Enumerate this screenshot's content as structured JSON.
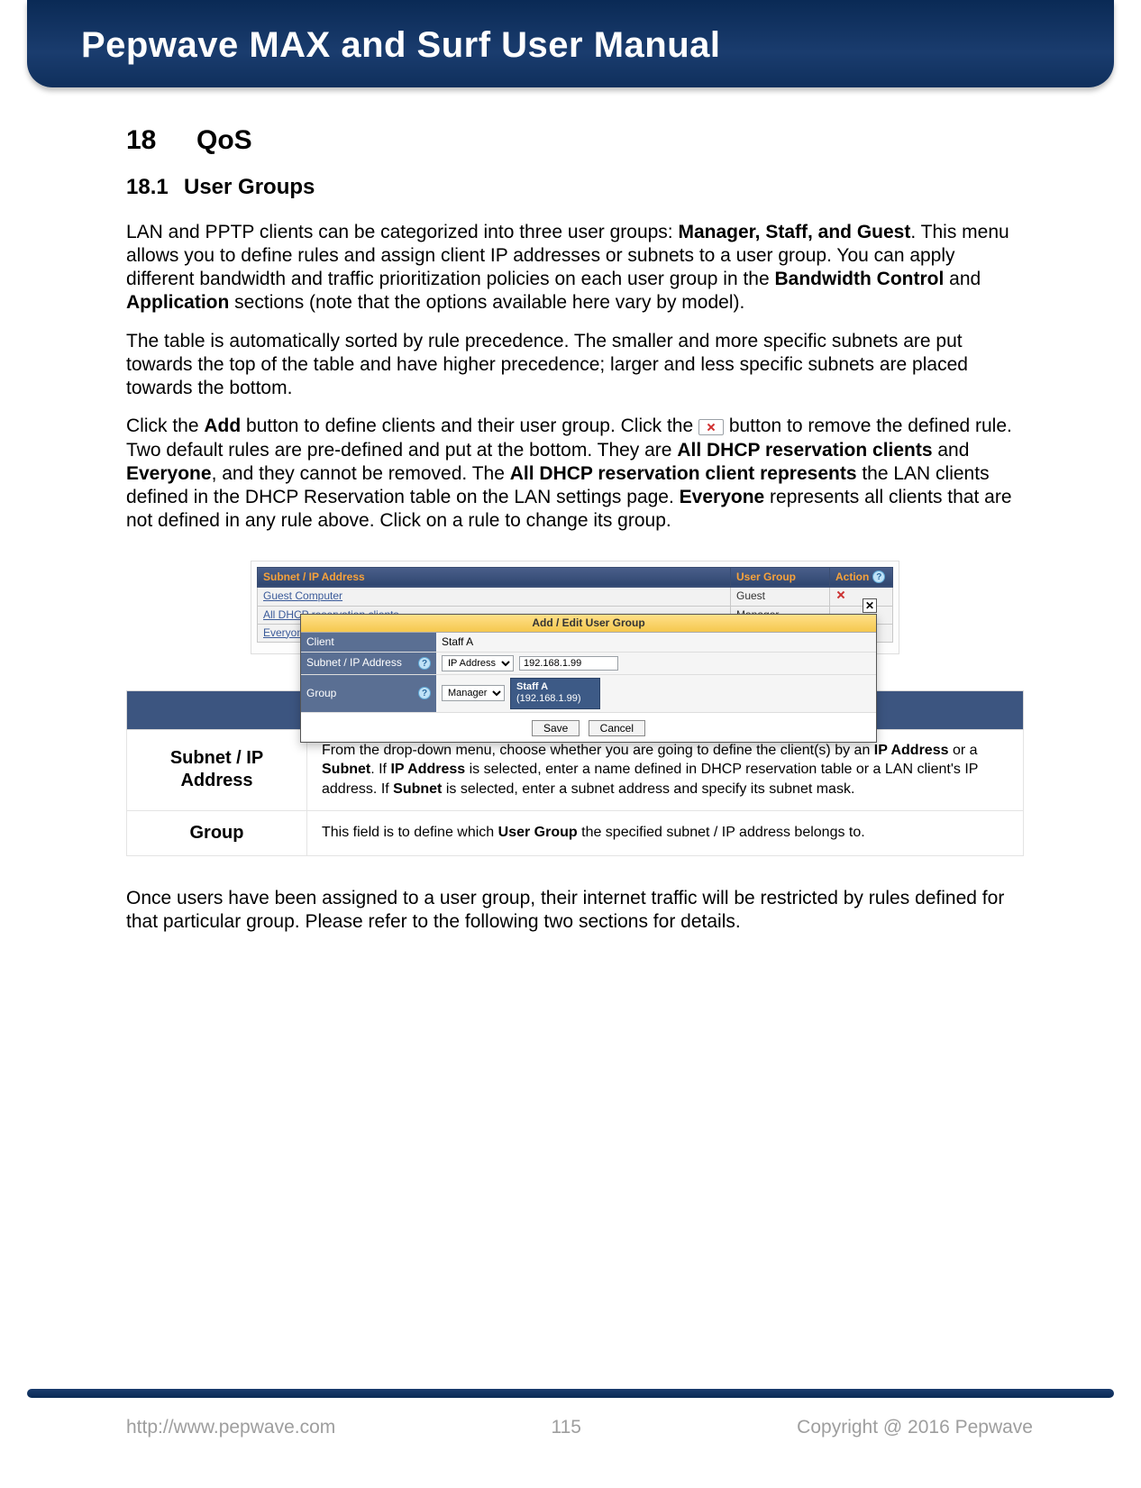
{
  "header": {
    "title": "Pepwave MAX and Surf User Manual"
  },
  "section": {
    "num": "18",
    "title": "QoS"
  },
  "subsection": {
    "num": "18.1",
    "title": "User Groups"
  },
  "para1": {
    "pre": "LAN and PPTP clients can be categorized into three user groups: ",
    "b1": "Manager, Staff, and Guest",
    "mid1": ". This menu allows you to define rules and assign client IP addresses or subnets to a user group. You can apply different bandwidth and traffic prioritization policies on each user group in the ",
    "b2": "Bandwidth Control",
    "mid2": " and ",
    "b3": "Application",
    "post": " sections (note that the options available here vary by model)."
  },
  "para2": "The table is automatically sorted by rule precedence. The smaller and more specific subnets are put towards the top of the table and have higher precedence; larger and less specific subnets are placed towards the bottom.",
  "para3": {
    "t1": "Click the ",
    "b1": "Add",
    "t2": " button to define clients and their user group. Click the ",
    "t3": " button to remove the defined rule. Two default rules are pre-defined and put at the bottom. They are ",
    "b2": "All DHCP reservation clients",
    "t4": " and ",
    "b3": "Everyone",
    "t5": ", and they cannot be removed. The ",
    "b4": "All DHCP reservation client represents",
    "t6": " the LAN clients defined in the DHCP Reservation table on the LAN settings page. ",
    "b5": "Everyone",
    "t7": " represents all clients that are not defined in any rule above. Click on a rule to change its group."
  },
  "ui_table": {
    "headers": {
      "c1": "Subnet / IP Address",
      "c2": "User Group",
      "c3": "Action"
    },
    "rows": [
      {
        "name": "Guest Computer",
        "group": "Guest",
        "delete": true
      },
      {
        "name": "All DHCP reservation clients",
        "group": "Manager",
        "delete": false
      },
      {
        "name": "Everyone",
        "group": "",
        "delete": false
      }
    ]
  },
  "popup": {
    "title": "Add / Edit User Group",
    "close": "✕",
    "client_label": "Client",
    "client_value": "Staff A",
    "subnet_label": "Subnet / IP Address",
    "subnet_type": "IP Address",
    "subnet_value": "192.168.1.99",
    "group_label": "Group",
    "group_value": "Manager",
    "tooltip_name": "Staff A",
    "tooltip_sub": "(192.168.1.99)",
    "save": "Save",
    "cancel": "Cancel",
    "help": "?"
  },
  "desc": {
    "header": "Add / Edit User Group",
    "row1_label": "Subnet / IP Address",
    "row1_text_a": "From the drop-down menu, choose whether you are going to define the client(s) by an ",
    "row1_b1": "IP Address",
    "row1_text_b": " or a ",
    "row1_b2": "Subnet",
    "row1_text_c": ". If ",
    "row1_b3": "IP Address",
    "row1_text_d": " is selected, enter a name defined in DHCP reservation table or a LAN client's IP address. If ",
    "row1_b4": "Subnet",
    "row1_text_e": " is selected, enter a subnet address and specify its subnet mask.",
    "row2_label": "Group",
    "row2_text_a": "This field is to define which ",
    "row2_b1": "User Group",
    "row2_text_b": " the specified subnet / IP address belongs to."
  },
  "para4": "Once users have been assigned to a user group, their internet traffic will be restricted by rules defined for that particular group. Please refer to the following two sections for details.",
  "footer": {
    "url": "http://www.pepwave.com",
    "page": "115",
    "copyright": "Copyright @ 2016 Pepwave"
  }
}
